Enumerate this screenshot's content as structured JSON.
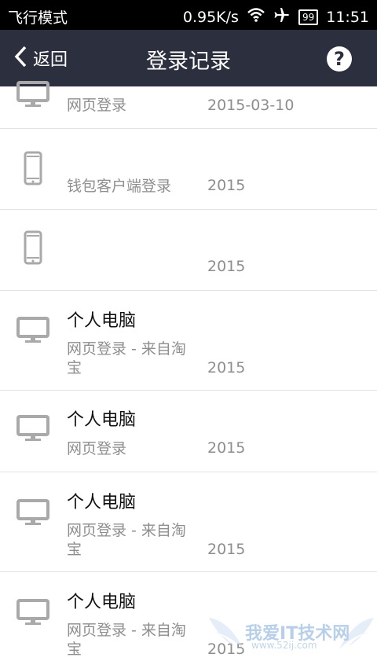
{
  "status_bar": {
    "mode": "飞行模式",
    "speed": "0.95K/s",
    "battery": "99",
    "time": "11:51"
  },
  "nav": {
    "back_label": "返回",
    "title": "登录记录",
    "help_label": "?"
  },
  "records": [
    {
      "device": "desktop",
      "name": "",
      "method": "网页登录",
      "date": "2015-03-10"
    },
    {
      "device": "phone",
      "name": "",
      "method": "钱包客户端登录",
      "date": "2015"
    },
    {
      "device": "phone",
      "name": "",
      "method": "",
      "date": "2015"
    },
    {
      "device": "desktop",
      "name": "个人电脑",
      "method": "网页登录 - 来自淘宝",
      "date": "2015"
    },
    {
      "device": "desktop",
      "name": "个人电脑",
      "method": "网页登录",
      "date": "2015"
    },
    {
      "device": "desktop",
      "name": "个人电脑",
      "method": "网页登录 - 来自淘宝",
      "date": "2015"
    },
    {
      "device": "desktop",
      "name": "个人电脑",
      "method": "网页登录 - 来自淘宝",
      "date": "2015"
    }
  ],
  "watermark": {
    "text": "我爱IT技术网",
    "url": "www.52ij.com"
  },
  "colors": {
    "nav_bg": "#2c2f3d",
    "status_bg": "#000000",
    "icon_gray": "#a9a9a9",
    "secondary_text": "#8e8e8e"
  }
}
